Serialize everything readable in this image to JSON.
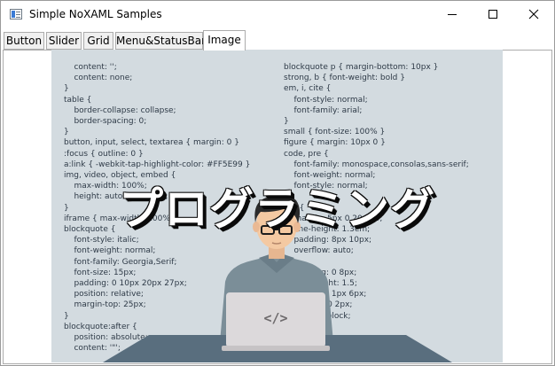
{
  "window": {
    "title": "Simple NoXAML Samples",
    "icon": "app-window-icon",
    "controls": [
      "minimize-icon",
      "maximize-icon",
      "close-icon"
    ]
  },
  "tabs": [
    {
      "label": "Button",
      "selected": false
    },
    {
      "label": "Slider",
      "selected": false
    },
    {
      "label": "Grid",
      "selected": false
    },
    {
      "label": "Menu&StatusBar",
      "selected": false
    },
    {
      "label": "Image",
      "selected": true
    }
  ],
  "image": {
    "headline": "プログラミング",
    "laptop_symbol": "</>",
    "code_left": [
      "    content: '';",
      "    content: none;",
      "}",
      "table {",
      "    border-collapse: collapse;",
      "    border-spacing: 0;",
      "}",
      "button, input, select, textarea { margin: 0 }",
      ":focus { outline: 0 }",
      "a:link { -webkit-tap-highlight-color: #FF5E99 }",
      "img, video, object, embed {",
      "    max-width: 100%;",
      "    height: auto!important;",
      "}",
      "iframe { max-width: 100% }",
      "blockquote {",
      "    font-style: italic;",
      "    font-weight: normal;",
      "    font-family: Georgia,Serif;",
      "    font-size: 15px;",
      "    padding: 0 10px 20px 27px;",
      "    position: relative;",
      "    margin-top: 25px;",
      "}",
      "blockquote:after {",
      "    position: absolute;",
      "    content: '\"';"
    ],
    "code_right": [
      "blockquote p { margin-bottom: 10px }",
      "strong, b { font-weight: bold }",
      "em, i, cite {",
      "    font-style: normal;",
      "    font-family: arial;",
      "}",
      "small { font-size: 100% }",
      "figure { margin: 10px 0 }",
      "code, pre {",
      "    font-family: monospace,consolas,sans-serif;",
      "    font-weight: normal;",
      "    font-style: normal;",
      "}",
      "pre {",
      "    margin: 5px 0 20px 0;",
      "    line-height: 1.3em;",
      "    padding: 8px 10px;",
      "    overflow: auto;",
      "}",
      "",
      "    padding: 0 8px;",
      "    line-height: 1.5;",
      "",
      "",
      "    padding: 1px 6px;",
      "    margin: 0 2px;",
      "    display: block;"
    ]
  },
  "colors": {
    "image_bg": "#d3dbe0",
    "code_text": "#2e3a47",
    "desk": "#596e7e",
    "laptop": "#dcd9db",
    "shirt": "#7b8e98",
    "skin": "#f4c9a2",
    "hair": "#2b2b2b"
  }
}
